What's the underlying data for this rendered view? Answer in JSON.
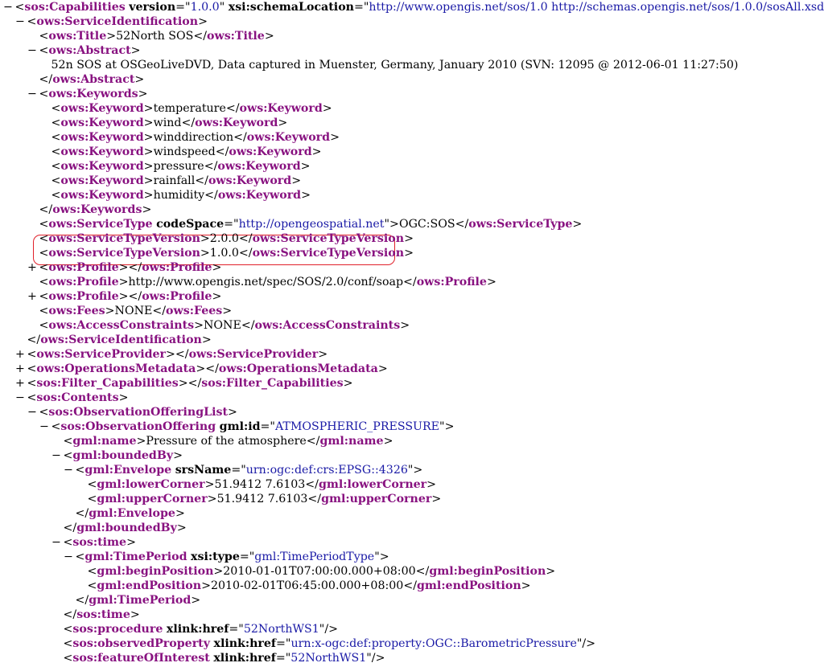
{
  "highlight_color": "#e0202a",
  "colors": {
    "tag": "#881280",
    "attribute_value": "#1a1aa6",
    "text": "#000000"
  },
  "lines": [
    {
      "toggle": "−",
      "indent": 0,
      "open": true,
      "tag": "sos:Capabilities",
      "attrs": [
        {
          "n": "version",
          "v": "1.0.0"
        },
        {
          "n": "xsi:schemaLocation",
          "v": "http://www.opengis.net/sos/1.0 http://schemas.opengis.net/sos/1.0.0/sosAll.xsd"
        }
      ],
      "text": "",
      "close": false
    },
    {
      "toggle": "−",
      "indent": 1,
      "open": true,
      "tag": "ows:ServiceIdentification",
      "attrs": [],
      "text": "",
      "close": false
    },
    {
      "toggle": "",
      "indent": 2,
      "open": true,
      "tag": "ows:Title",
      "attrs": [],
      "text": "52North SOS",
      "close": true
    },
    {
      "toggle": "−",
      "indent": 2,
      "open": true,
      "tag": "ows:Abstract",
      "attrs": [],
      "text": "",
      "close": false
    },
    {
      "toggle": "",
      "indent": 3,
      "open": false,
      "tag": "",
      "attrs": [],
      "text": "52n SOS at OSGeoLiveDVD, Data captured in Muenster, Germany, January 2010 (SVN: 12095 @ 2012-06-01 11:27:50)",
      "close": false
    },
    {
      "toggle": "",
      "indent": 2,
      "open": false,
      "tag": "ows:Abstract",
      "attrs": [],
      "text": "",
      "close": true
    },
    {
      "toggle": "−",
      "indent": 2,
      "open": true,
      "tag": "ows:Keywords",
      "attrs": [],
      "text": "",
      "close": false
    },
    {
      "toggle": "",
      "indent": 3,
      "open": true,
      "tag": "ows:Keyword",
      "attrs": [],
      "text": "temperature",
      "close": true
    },
    {
      "toggle": "",
      "indent": 3,
      "open": true,
      "tag": "ows:Keyword",
      "attrs": [],
      "text": "wind",
      "close": true
    },
    {
      "toggle": "",
      "indent": 3,
      "open": true,
      "tag": "ows:Keyword",
      "attrs": [],
      "text": "winddirection",
      "close": true
    },
    {
      "toggle": "",
      "indent": 3,
      "open": true,
      "tag": "ows:Keyword",
      "attrs": [],
      "text": "windspeed",
      "close": true
    },
    {
      "toggle": "",
      "indent": 3,
      "open": true,
      "tag": "ows:Keyword",
      "attrs": [],
      "text": "pressure",
      "close": true
    },
    {
      "toggle": "",
      "indent": 3,
      "open": true,
      "tag": "ows:Keyword",
      "attrs": [],
      "text": "rainfall",
      "close": true
    },
    {
      "toggle": "",
      "indent": 3,
      "open": true,
      "tag": "ows:Keyword",
      "attrs": [],
      "text": "humidity",
      "close": true
    },
    {
      "toggle": "",
      "indent": 2,
      "open": false,
      "tag": "ows:Keywords",
      "attrs": [],
      "text": "",
      "close": true
    },
    {
      "toggle": "",
      "indent": 2,
      "open": true,
      "tag": "ows:ServiceType",
      "attrs": [
        {
          "n": "codeSpace",
          "v": "http://opengeospatial.net"
        }
      ],
      "text": "OGC:SOS",
      "close": true
    },
    {
      "toggle": "",
      "indent": 2,
      "open": true,
      "tag": "ows:ServiceTypeVersion",
      "attrs": [],
      "text": "2.0.0",
      "close": true
    },
    {
      "toggle": "",
      "indent": 2,
      "open": true,
      "tag": "ows:ServiceTypeVersion",
      "attrs": [],
      "text": "1.0.0",
      "close": true
    },
    {
      "toggle": "+",
      "indent": 2,
      "open": true,
      "tag": "ows:Profile",
      "attrs": [],
      "text": "",
      "close": true
    },
    {
      "toggle": "",
      "indent": 2,
      "open": true,
      "tag": "ows:Profile",
      "attrs": [],
      "text": "http://www.opengis.net/spec/SOS/2.0/conf/soap",
      "close": true
    },
    {
      "toggle": "+",
      "indent": 2,
      "open": true,
      "tag": "ows:Profile",
      "attrs": [],
      "text": "",
      "close": true
    },
    {
      "toggle": "",
      "indent": 2,
      "open": true,
      "tag": "ows:Fees",
      "attrs": [],
      "text": "NONE",
      "close": true
    },
    {
      "toggle": "",
      "indent": 2,
      "open": true,
      "tag": "ows:AccessConstraints",
      "attrs": [],
      "text": "NONE",
      "close": true
    },
    {
      "toggle": "",
      "indent": 1,
      "open": false,
      "tag": "ows:ServiceIdentification",
      "attrs": [],
      "text": "",
      "close": true
    },
    {
      "toggle": "+",
      "indent": 1,
      "open": true,
      "tag": "ows:ServiceProvider",
      "attrs": [],
      "text": "",
      "close": true
    },
    {
      "toggle": "+",
      "indent": 1,
      "open": true,
      "tag": "ows:OperationsMetadata",
      "attrs": [],
      "text": "",
      "close": true
    },
    {
      "toggle": "+",
      "indent": 1,
      "open": true,
      "tag": "sos:Filter_Capabilities",
      "attrs": [],
      "text": "",
      "close": true
    },
    {
      "toggle": "−",
      "indent": 1,
      "open": true,
      "tag": "sos:Contents",
      "attrs": [],
      "text": "",
      "close": false
    },
    {
      "toggle": "−",
      "indent": 2,
      "open": true,
      "tag": "sos:ObservationOfferingList",
      "attrs": [],
      "text": "",
      "close": false
    },
    {
      "toggle": "−",
      "indent": 3,
      "open": true,
      "tag": "sos:ObservationOffering",
      "attrs": [
        {
          "n": "gml:id",
          "v": "ATMOSPHERIC_PRESSURE"
        }
      ],
      "text": "",
      "close": false
    },
    {
      "toggle": "",
      "indent": 4,
      "open": true,
      "tag": "gml:name",
      "attrs": [],
      "text": "Pressure of the atmosphere",
      "close": true
    },
    {
      "toggle": "−",
      "indent": 4,
      "open": true,
      "tag": "gml:boundedBy",
      "attrs": [],
      "text": "",
      "close": false
    },
    {
      "toggle": "−",
      "indent": 5,
      "open": true,
      "tag": "gml:Envelope",
      "attrs": [
        {
          "n": "srsName",
          "v": "urn:ogc:def:crs:EPSG::4326"
        }
      ],
      "text": "",
      "close": false
    },
    {
      "toggle": "",
      "indent": 6,
      "open": true,
      "tag": "gml:lowerCorner",
      "attrs": [],
      "text": "51.9412 7.6103",
      "close": true
    },
    {
      "toggle": "",
      "indent": 6,
      "open": true,
      "tag": "gml:upperCorner",
      "attrs": [],
      "text": "51.9412 7.6103",
      "close": true
    },
    {
      "toggle": "",
      "indent": 5,
      "open": false,
      "tag": "gml:Envelope",
      "attrs": [],
      "text": "",
      "close": true
    },
    {
      "toggle": "",
      "indent": 4,
      "open": false,
      "tag": "gml:boundedBy",
      "attrs": [],
      "text": "",
      "close": true
    },
    {
      "toggle": "−",
      "indent": 4,
      "open": true,
      "tag": "sos:time",
      "attrs": [],
      "text": "",
      "close": false
    },
    {
      "toggle": "−",
      "indent": 5,
      "open": true,
      "tag": "gml:TimePeriod",
      "attrs": [
        {
          "n": "xsi:type",
          "v": "gml:TimePeriodType"
        }
      ],
      "text": "",
      "close": false
    },
    {
      "toggle": "",
      "indent": 6,
      "open": true,
      "tag": "gml:beginPosition",
      "attrs": [],
      "text": "2010-01-01T07:00:00.000+08:00",
      "close": true
    },
    {
      "toggle": "",
      "indent": 6,
      "open": true,
      "tag": "gml:endPosition",
      "attrs": [],
      "text": "2010-02-01T06:45:00.000+08:00",
      "close": true
    },
    {
      "toggle": "",
      "indent": 5,
      "open": false,
      "tag": "gml:TimePeriod",
      "attrs": [],
      "text": "",
      "close": true
    },
    {
      "toggle": "",
      "indent": 4,
      "open": false,
      "tag": "sos:time",
      "attrs": [],
      "text": "",
      "close": true
    },
    {
      "toggle": "",
      "indent": 4,
      "open": true,
      "tag": "sos:procedure",
      "attrs": [
        {
          "n": "xlink:href",
          "v": "52NorthWS1"
        }
      ],
      "text": "",
      "close": false,
      "selfclose": true
    },
    {
      "toggle": "",
      "indent": 4,
      "open": true,
      "tag": "sos:observedProperty",
      "attrs": [
        {
          "n": "xlink:href",
          "v": "urn:x-ogc:def:property:OGC::BarometricPressure"
        }
      ],
      "text": "",
      "close": false,
      "selfclose": true
    },
    {
      "toggle": "",
      "indent": 4,
      "open": true,
      "tag": "sos:featureOfInterest",
      "attrs": [
        {
          "n": "xlink:href",
          "v": "52NorthWS1"
        }
      ],
      "text": "",
      "close": false,
      "selfclose": true
    }
  ]
}
